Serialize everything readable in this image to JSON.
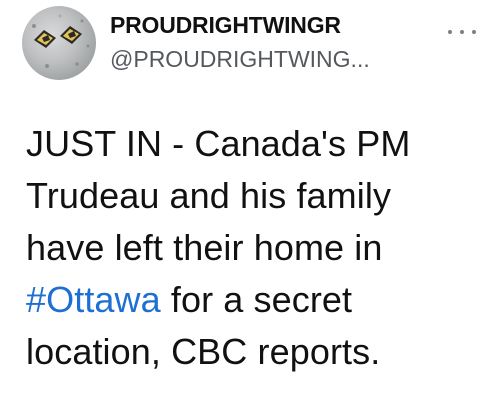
{
  "tweet": {
    "display_name": "PROUDRIGHTWINGR",
    "handle": "@PROUDRIGHTWING...",
    "more_icon": "more-horizontal-icon",
    "text_line1": "JUST IN - Canada's PM",
    "text_line2": "Trudeau and his family",
    "text_line3": "have left their home in",
    "hashtag": "#Ottawa",
    "text_line4_rest": " for a secret",
    "text_line5": "location, CBC reports."
  },
  "colors": {
    "hashtag": "#1d6fd1",
    "handle": "#55595e",
    "text": "#111111"
  }
}
